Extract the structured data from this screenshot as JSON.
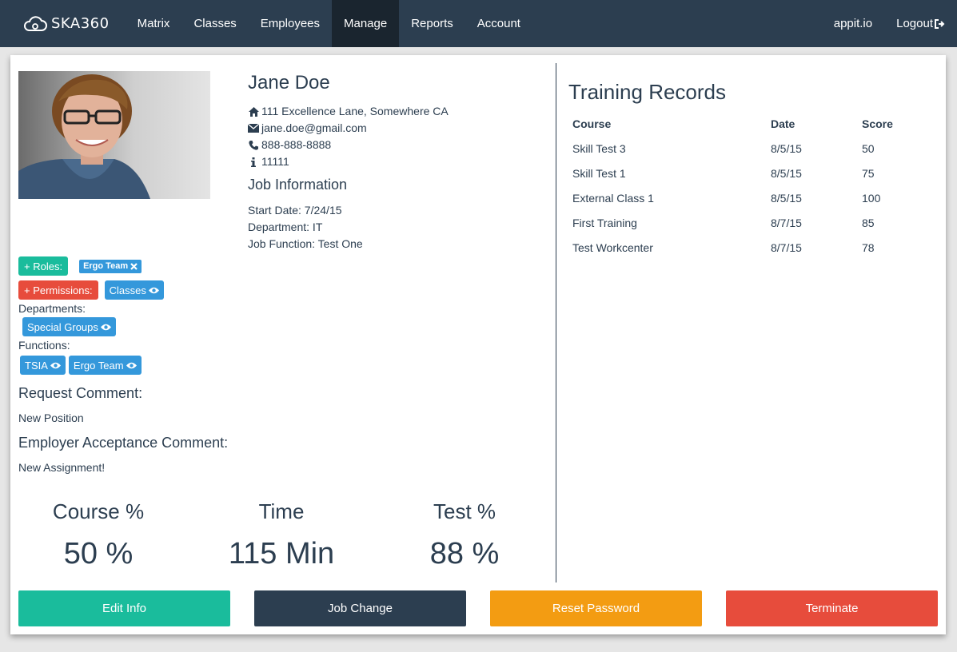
{
  "nav": {
    "brand": "SKA360",
    "items": [
      "Matrix",
      "Classes",
      "Employees",
      "Manage",
      "Reports",
      "Account"
    ],
    "active_index": 3,
    "right": {
      "site": "appit.io",
      "logout": "Logout"
    }
  },
  "employee": {
    "name": "Jane Doe",
    "address": "111 Excellence Lane, Somewhere CA",
    "email": "jane.doe@gmail.com",
    "phone": "888-888-8888",
    "id": "11111",
    "icons": [
      "home-icon",
      "envelope-icon",
      "phone-icon",
      "info-icon"
    ]
  },
  "job": {
    "heading": "Job Information",
    "start_date": "Start Date: 7/24/15",
    "department": "Department: IT",
    "function": "Job Function: Test One"
  },
  "tags": {
    "roles_button": "+ Roles:",
    "roles": [
      "Ergo Team"
    ],
    "permissions_button": "+ Permissions:",
    "permissions": [
      "Classes"
    ],
    "departments_label": "Departments:",
    "departments": [
      "Special Groups"
    ],
    "functions_label": "Functions:",
    "functions": [
      "TSIA",
      "Ergo Team"
    ]
  },
  "comments": {
    "request_heading": "Request Comment:",
    "request_text": "New Position",
    "employer_heading": "Employer Acceptance Comment:",
    "employer_text": "New Assignment!"
  },
  "stats": [
    {
      "label": "Course %",
      "value": "50 %"
    },
    {
      "label": "Time",
      "value": "115 Min"
    },
    {
      "label": "Test %",
      "value": "88 %"
    }
  ],
  "training": {
    "title": "Training Records",
    "columns": [
      "Course",
      "Date",
      "Score"
    ],
    "rows": [
      [
        "Skill Test 3",
        "8/5/15",
        "50"
      ],
      [
        "Skill Test 1",
        "8/5/15",
        "75"
      ],
      [
        "External Class 1",
        "8/5/15",
        "100"
      ],
      [
        "First Training",
        "8/7/15",
        "85"
      ],
      [
        "Test Workcenter",
        "8/7/15",
        "78"
      ]
    ]
  },
  "actions": {
    "edit": "Edit Info",
    "job_change": "Job Change",
    "reset": "Reset Password",
    "terminate": "Terminate"
  },
  "colors": {
    "navbar": "#2c3e50",
    "teal": "#1abc9c",
    "red": "#e74c3c",
    "blue": "#3498db",
    "orange": "#f39c12"
  }
}
